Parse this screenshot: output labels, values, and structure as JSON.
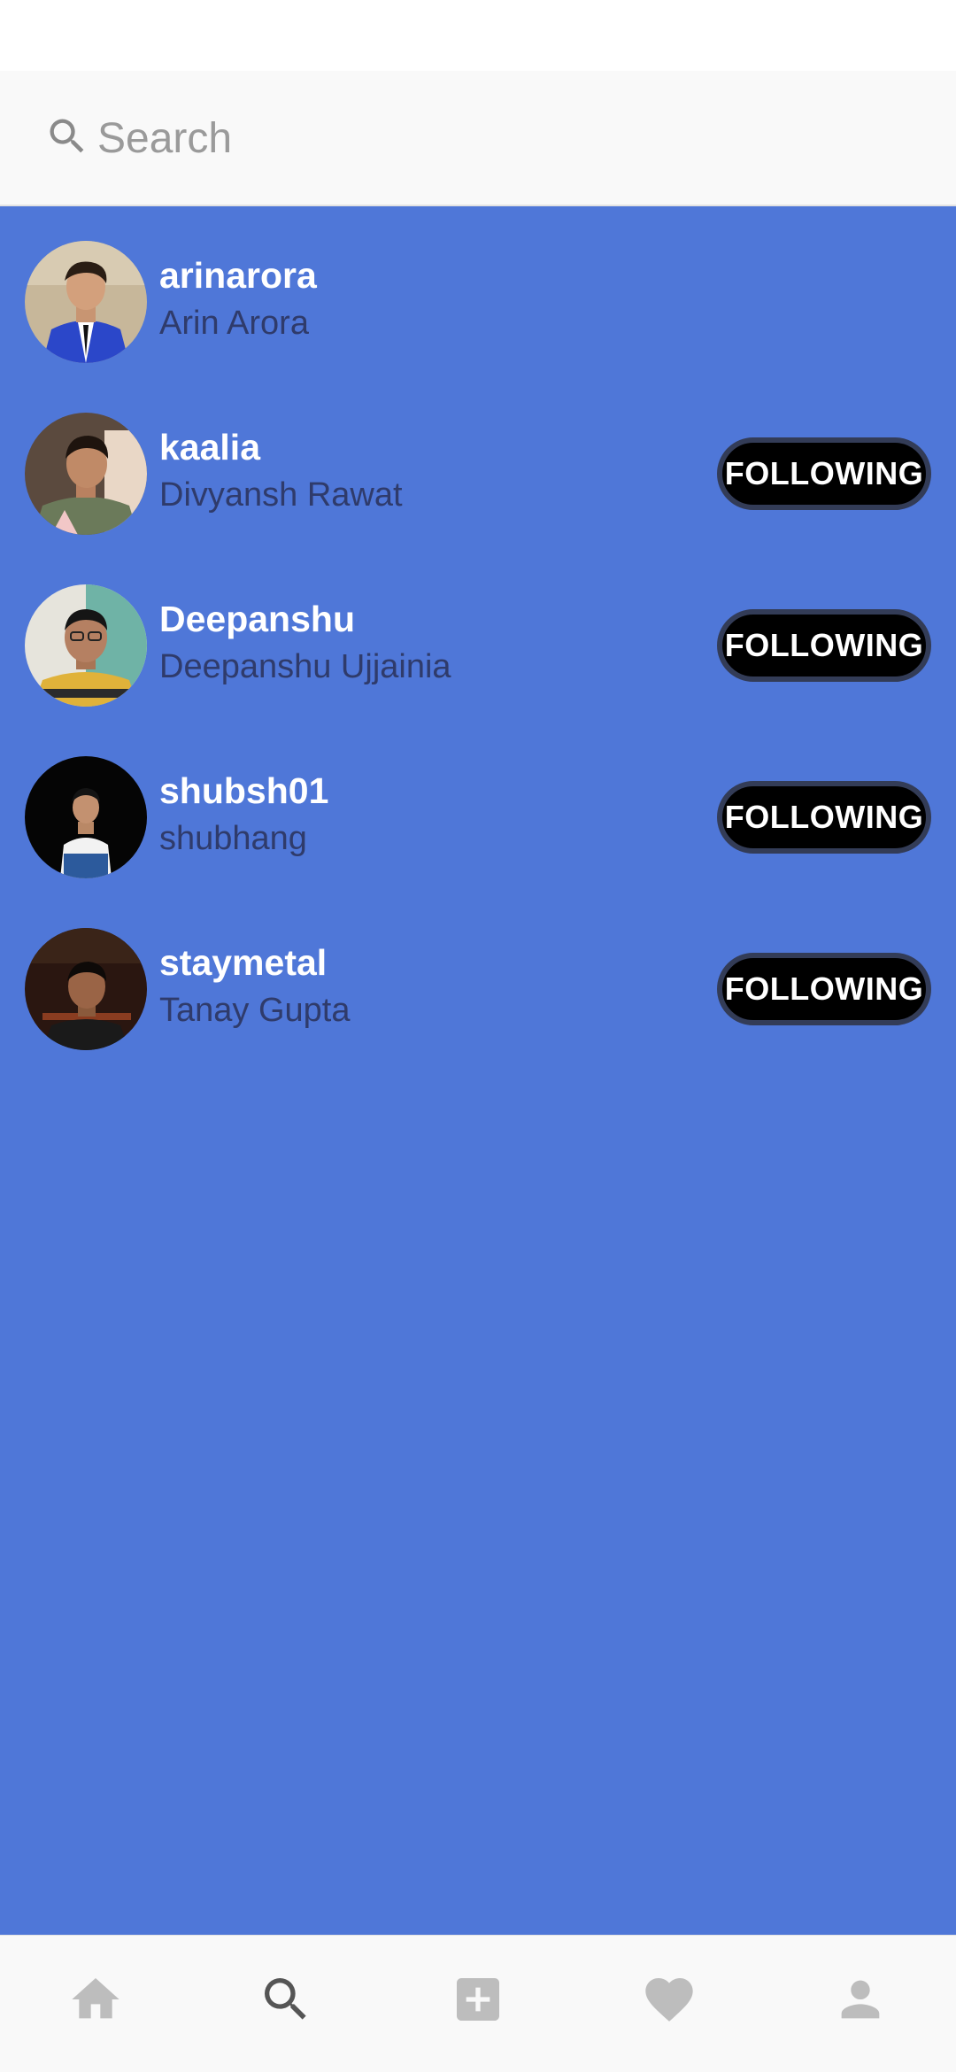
{
  "search": {
    "placeholder": "Search",
    "value": ""
  },
  "theme": {
    "list_background": "#4f77d8",
    "button_background": "#000000",
    "username_color": "#ffffff",
    "fullname_color": "#2f3b6b",
    "nav_active_color": "#555555",
    "nav_inactive_color": "#bdbdbd"
  },
  "users": [
    {
      "username": "arinarora",
      "name": "Arin Arora",
      "button": ""
    },
    {
      "username": "kaalia",
      "name": "Divyansh Rawat",
      "button": "FOLLOWING"
    },
    {
      "username": "Deepanshu",
      "name": "Deepanshu Ujjainia",
      "button": "FOLLOWING"
    },
    {
      "username": "shubsh01",
      "name": "shubhang",
      "button": "FOLLOWING"
    },
    {
      "username": "staymetal",
      "name": "Tanay Gupta",
      "button": "FOLLOWING"
    }
  ],
  "bottom_nav": [
    {
      "icon": "home-icon",
      "active": false
    },
    {
      "icon": "search-icon",
      "active": true
    },
    {
      "icon": "add-icon",
      "active": false
    },
    {
      "icon": "heart-icon",
      "active": false
    },
    {
      "icon": "profile-icon",
      "active": false
    }
  ]
}
